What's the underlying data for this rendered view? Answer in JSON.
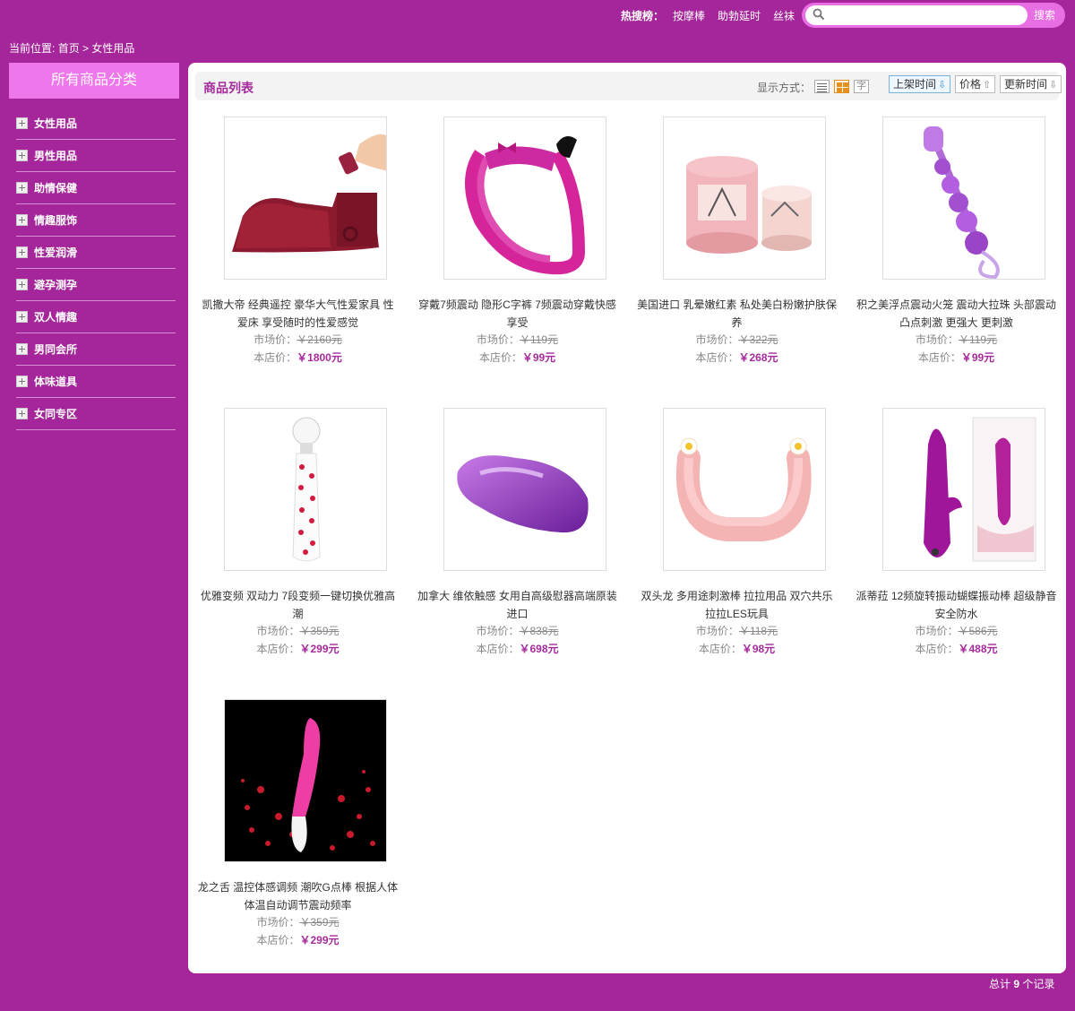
{
  "header": {
    "hot_label": "热搜榜：",
    "hot_links": [
      "按摩棒",
      "助勃延时",
      "丝袜"
    ],
    "search_placeholder": "",
    "search_button": "搜索"
  },
  "breadcrumb": {
    "prefix": "当前位置:",
    "home": "首页",
    "sep": ">",
    "current": "女性用品"
  },
  "sidebar": {
    "title": "所有商品分类",
    "items": [
      "女性用品",
      "男性用品",
      "助情保健",
      "情趣服饰",
      "性爱润滑",
      "避孕测孕",
      "双人情趣",
      "男同会所",
      "体味道具",
      "女同专区"
    ]
  },
  "list": {
    "title": "商品列表",
    "display_label": "显示方式：",
    "text_view_glyph": "字",
    "sort": [
      {
        "label": "上架时间",
        "arrow": "⇩"
      },
      {
        "label": "价格",
        "arrow": "⇧"
      },
      {
        "label": "更新时间",
        "arrow": "⇩"
      }
    ]
  },
  "price_labels": {
    "market": "市场价：",
    "ours": "本店价："
  },
  "products": [
    {
      "name": "凯撒大帝 经典遥控 豪华大气性爱家具 性爱床 享受随时的性爱感觉",
      "market": "￥2160元",
      "price": "￥1800元",
      "image": "wedge-furniture"
    },
    {
      "name": "穿戴7频震动 隐形C字裤 7频震动穿戴快感享受",
      "market": "￥119元",
      "price": "￥99元",
      "image": "c-string"
    },
    {
      "name": "美国进口 乳晕嫩红素 私处美白粉嫩护肤保养",
      "market": "￥322元",
      "price": "￥268元",
      "image": "cream-jars"
    },
    {
      "name": "积之美浮点震动火笼 震动大拉珠 头部震动 凸点刺激 更强大 更刺激",
      "market": "￥119元",
      "price": "￥99元",
      "image": "anal-beads"
    },
    {
      "name": "优雅变频 双动力 7段变频一键切换优雅高潮",
      "market": "￥359元",
      "price": "￥299元",
      "image": "wand"
    },
    {
      "name": "加拿大 维依触感 女用自高级慰器高端原装进口",
      "market": "￥838元",
      "price": "￥698元",
      "image": "purple-egg"
    },
    {
      "name": "双头龙 多用途刺激棒 拉拉用品 双穴共乐 拉拉LES玩具",
      "market": "￥118元",
      "price": "￥98元",
      "image": "double-dildo"
    },
    {
      "name": "派蒂菈 12频旋转振动蝴蝶振动棒 超级静音安全防水",
      "market": "￥586元",
      "price": "￥488元",
      "image": "rabbit-vibe"
    },
    {
      "name": "龙之舌 温控体感调频 潮吹G点棒 根据人体体温自动调节震动频率",
      "market": "￥359元",
      "price": "￥299元",
      "image": "g-spot-vibe"
    }
  ],
  "footer": {
    "prefix": "总计",
    "count": "9",
    "suffix": "个记录"
  }
}
